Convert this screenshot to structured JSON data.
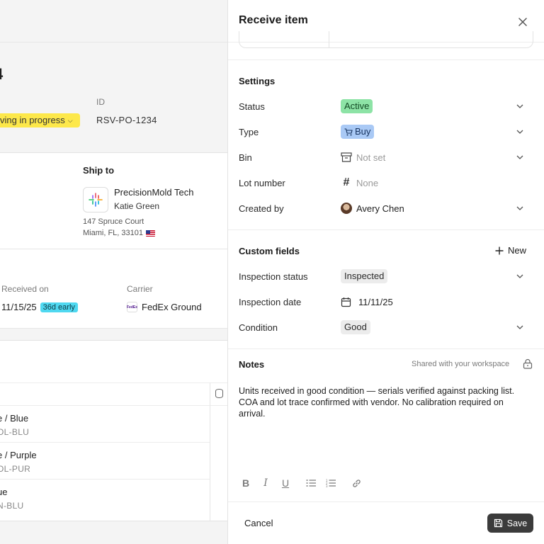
{
  "background": {
    "title_fragment": "4",
    "status_label": "ving in progress",
    "id_label": "ID",
    "id_value": "RSV-PO-1234",
    "ship_to": {
      "label": "Ship to",
      "company": "PrecisionMold Tech",
      "person": "Katie Green",
      "address1": "147 Spruce Court",
      "address2": "Miami, FL, 33101"
    },
    "received_on_label": "Received on",
    "received_on_value": "11/15/25",
    "received_badge": "36d early",
    "carrier_label": "Carrier",
    "carrier_value": "FedEx Ground",
    "items": [
      {
        "name": "e / Blue",
        "sku": "OL-BLU"
      },
      {
        "name": "e / Purple",
        "sku": "OL-PUR"
      },
      {
        "name": "ue",
        "sku": "N-BLU"
      }
    ]
  },
  "drawer": {
    "title": "Receive item",
    "settings": {
      "title": "Settings",
      "fields": {
        "status_label": "Status",
        "status_value": "Active",
        "type_label": "Type",
        "type_value": "Buy",
        "bin_label": "Bin",
        "bin_value": "Not set",
        "lot_label": "Lot number",
        "lot_value": "None",
        "created_label": "Created by",
        "created_value": "Avery Chen"
      }
    },
    "custom_fields": {
      "title": "Custom fields",
      "new_label": "New",
      "inspection_status_label": "Inspection status",
      "inspection_status_value": "Inspected",
      "inspection_date_label": "Inspection date",
      "inspection_date_value": "11/11/25",
      "condition_label": "Condition",
      "condition_value": "Good"
    },
    "notes": {
      "title": "Notes",
      "shared": "Shared with your workspace",
      "text": "Units received in good condition — serials verified against packing list. COA and lot trace confirmed with vendor. No calibration required on arrival."
    },
    "footer": {
      "cancel": "Cancel",
      "save": "Save"
    }
  },
  "colors": {
    "active_green": "#8de3a6",
    "buy_blue": "#a9c9f5",
    "status_yellow": "#fde84a",
    "early_cyan": "#4fd8f0",
    "save_bg": "#3b3b3b"
  }
}
